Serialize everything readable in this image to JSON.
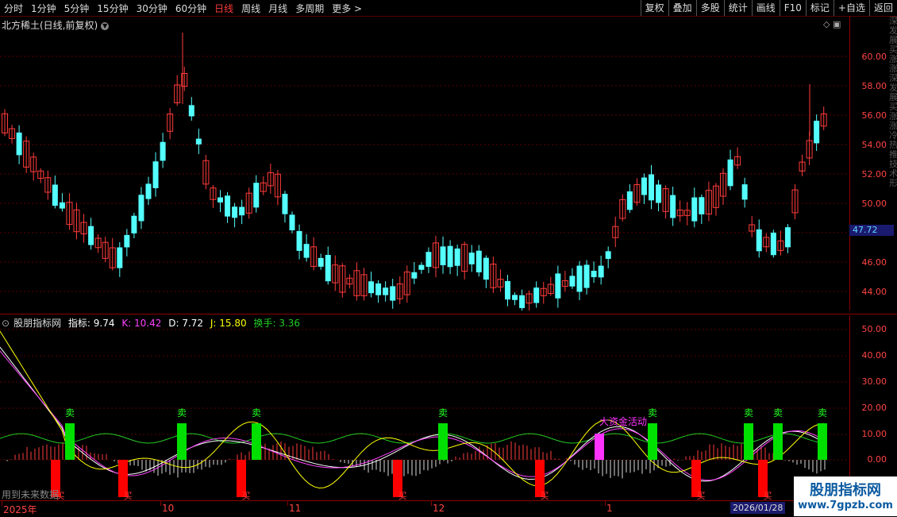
{
  "toolbar": {
    "periods": [
      "分时",
      "1分钟",
      "5分钟",
      "15分钟",
      "30分钟",
      "60分钟",
      "日线",
      "周线",
      "月线",
      "多周期",
      "更多 >"
    ],
    "active_period": "日线",
    "right_buttons": [
      "复权",
      "叠加",
      "多股",
      "统计",
      "画线",
      "F10",
      "标记",
      "+自选",
      "返回"
    ]
  },
  "stock": {
    "title": "北方稀土(日线,前复权)",
    "current_price": "47.72"
  },
  "price_axis": {
    "labels": [
      "60.00",
      "58.00",
      "56.00",
      "54.00",
      "52.00",
      "50.00",
      "48.00",
      "46.00",
      "44.00"
    ]
  },
  "indicator": {
    "name": "股朋指标网",
    "values": [
      {
        "label": "指标: 9.74",
        "color": "#ffffff"
      },
      {
        "label": "K: 10.42",
        "color": "#ff44ff"
      },
      {
        "label": "D: 7.72",
        "color": "#ffffff"
      },
      {
        "label": "J: 15.80",
        "color": "#ffff00"
      },
      {
        "label": "换手: 3.36",
        "color": "#22cc22"
      }
    ],
    "axis_labels": [
      "50.00",
      "40.00",
      "30.00",
      "20.00",
      "10.00",
      "0.00"
    ],
    "sell_text": "卖",
    "buy_text": "买",
    "big_money_text": "大资金活动"
  },
  "dates": {
    "labels": [
      "2025年",
      "10",
      "11",
      "12",
      "1"
    ],
    "current": "2026/01/28"
  },
  "left_note": "用到未来数据",
  "watermark": {
    "line1": "股朋指标网",
    "line2": "www.7gpzb.com"
  },
  "right_strip_text": "深发展买涨涨深发展买涨涨冷热推技术形"
}
